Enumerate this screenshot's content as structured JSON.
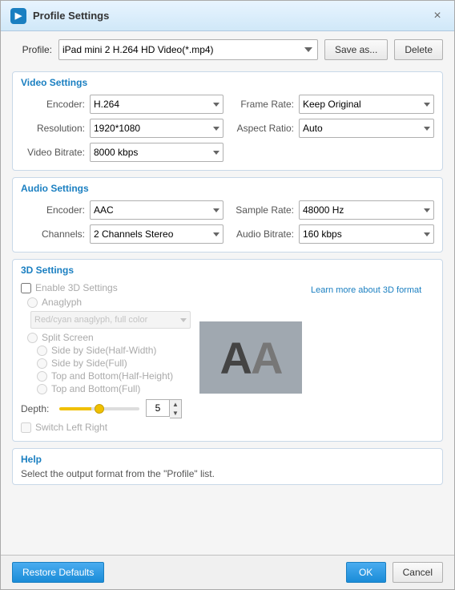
{
  "titleBar": {
    "title": "Profile Settings",
    "closeLabel": "×"
  },
  "profile": {
    "label": "Profile:",
    "value": "iPad mini 2 H.264 HD Video(*.mp4)",
    "saveAsLabel": "Save as...",
    "deleteLabel": "Delete"
  },
  "videoSettings": {
    "sectionLabel": "Video Settings",
    "encoderLabel": "Encoder:",
    "encoderValue": "H.264",
    "resolutionLabel": "Resolution:",
    "resolutionValue": "1920*1080",
    "videoBitrateLabel": "Video Bitrate:",
    "videoBitrateValue": "8000 kbps",
    "frameRateLabel": "Frame Rate:",
    "frameRateValue": "Keep Original",
    "aspectRatioLabel": "Aspect Ratio:",
    "aspectRatioValue": "Auto"
  },
  "audioSettings": {
    "sectionLabel": "Audio Settings",
    "encoderLabel": "Encoder:",
    "encoderValue": "AAC",
    "channelsLabel": "Channels:",
    "channelsValue": "2 Channels Stereo",
    "sampleRateLabel": "Sample Rate:",
    "sampleRateValue": "48000 Hz",
    "audioBitrateLabel": "Audio Bitrate:",
    "audioBitrateValue": "160 kbps"
  },
  "settings3D": {
    "sectionLabel": "3D Settings",
    "enableLabel": "Enable 3D Settings",
    "anaglyphLabel": "Anaglyph",
    "anaglyphOption": "Red/cyan anaglyph, full color",
    "splitScreenLabel": "Split Screen",
    "sbs_half": "Side by Side(Half-Width)",
    "sbs_full": "Side by Side(Full)",
    "tab_half": "Top and Bottom(Half-Height)",
    "tab_full": "Top and Bottom(Full)",
    "depthLabel": "Depth:",
    "depthValue": "5",
    "switchLRLabel": "Switch Left Right",
    "learnMoreLabel": "Learn more about 3D format",
    "aaLeft": "A",
    "aaRight": "A"
  },
  "help": {
    "sectionLabel": "Help",
    "helpText": "Select the output format from the \"Profile\" list."
  },
  "footer": {
    "restoreLabel": "Restore Defaults",
    "okLabel": "OK",
    "cancelLabel": "Cancel"
  }
}
